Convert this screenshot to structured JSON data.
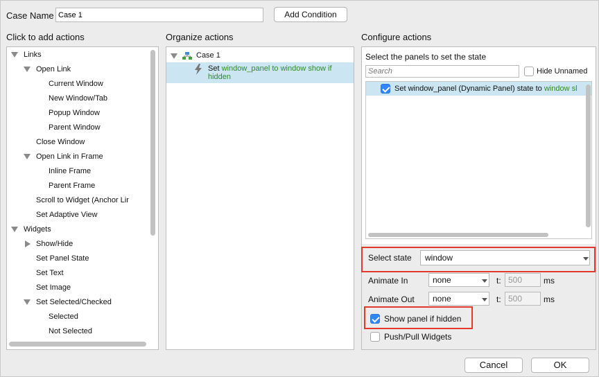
{
  "header": {
    "case_name_label": "Case Name",
    "case_name_value": "Case 1",
    "add_condition_label": "Add Condition"
  },
  "left": {
    "title": "Click to add actions",
    "items": [
      {
        "label": "Links"
      },
      {
        "label": "Open Link"
      },
      {
        "label": "Current Window"
      },
      {
        "label": "New Window/Tab"
      },
      {
        "label": "Popup Window"
      },
      {
        "label": "Parent Window"
      },
      {
        "label": "Close Window"
      },
      {
        "label": "Open Link in Frame"
      },
      {
        "label": "Inline Frame"
      },
      {
        "label": "Parent Frame"
      },
      {
        "label": "Scroll to Widget (Anchor Lir"
      },
      {
        "label": "Set Adaptive View"
      },
      {
        "label": "Widgets"
      },
      {
        "label": "Show/Hide"
      },
      {
        "label": "Set Panel State"
      },
      {
        "label": "Set Text"
      },
      {
        "label": "Set Image"
      },
      {
        "label": "Set Selected/Checked"
      },
      {
        "label": "Selected"
      },
      {
        "label": "Not Selected"
      }
    ]
  },
  "middle": {
    "title": "Organize actions",
    "case_label": "Case 1",
    "action_set": "Set",
    "action_target": "window_panel to window show if hidden"
  },
  "right": {
    "title": "Configure actions",
    "panels_title": "Select the panels to set the state",
    "search_placeholder": "Search",
    "hide_unnamed_label": "Hide Unnamed",
    "row_text": "Set window_panel (Dynamic Panel) state to",
    "row_state": "window sl",
    "select_state_label": "Select state",
    "select_state_value": "window",
    "animate_in_label": "Animate In",
    "animate_in_value": "none",
    "animate_in_t_label": "t:",
    "animate_in_t_value": "500",
    "animate_in_ms": "ms",
    "animate_out_label": "Animate Out",
    "animate_out_value": "none",
    "animate_out_t_label": "t:",
    "animate_out_t_value": "500",
    "animate_out_ms": "ms",
    "show_panel_label": "Show panel if hidden",
    "show_panel_checked": true,
    "push_pull_label": "Push/Pull Widgets",
    "push_pull_checked": false
  },
  "footer": {
    "cancel_label": "Cancel",
    "ok_label": "OK"
  },
  "colors": {
    "accent": "#2f86f6",
    "highlight_row": "#cbe6f2",
    "red_highlight": "#e2392b",
    "green_text": "#2d8b27"
  }
}
